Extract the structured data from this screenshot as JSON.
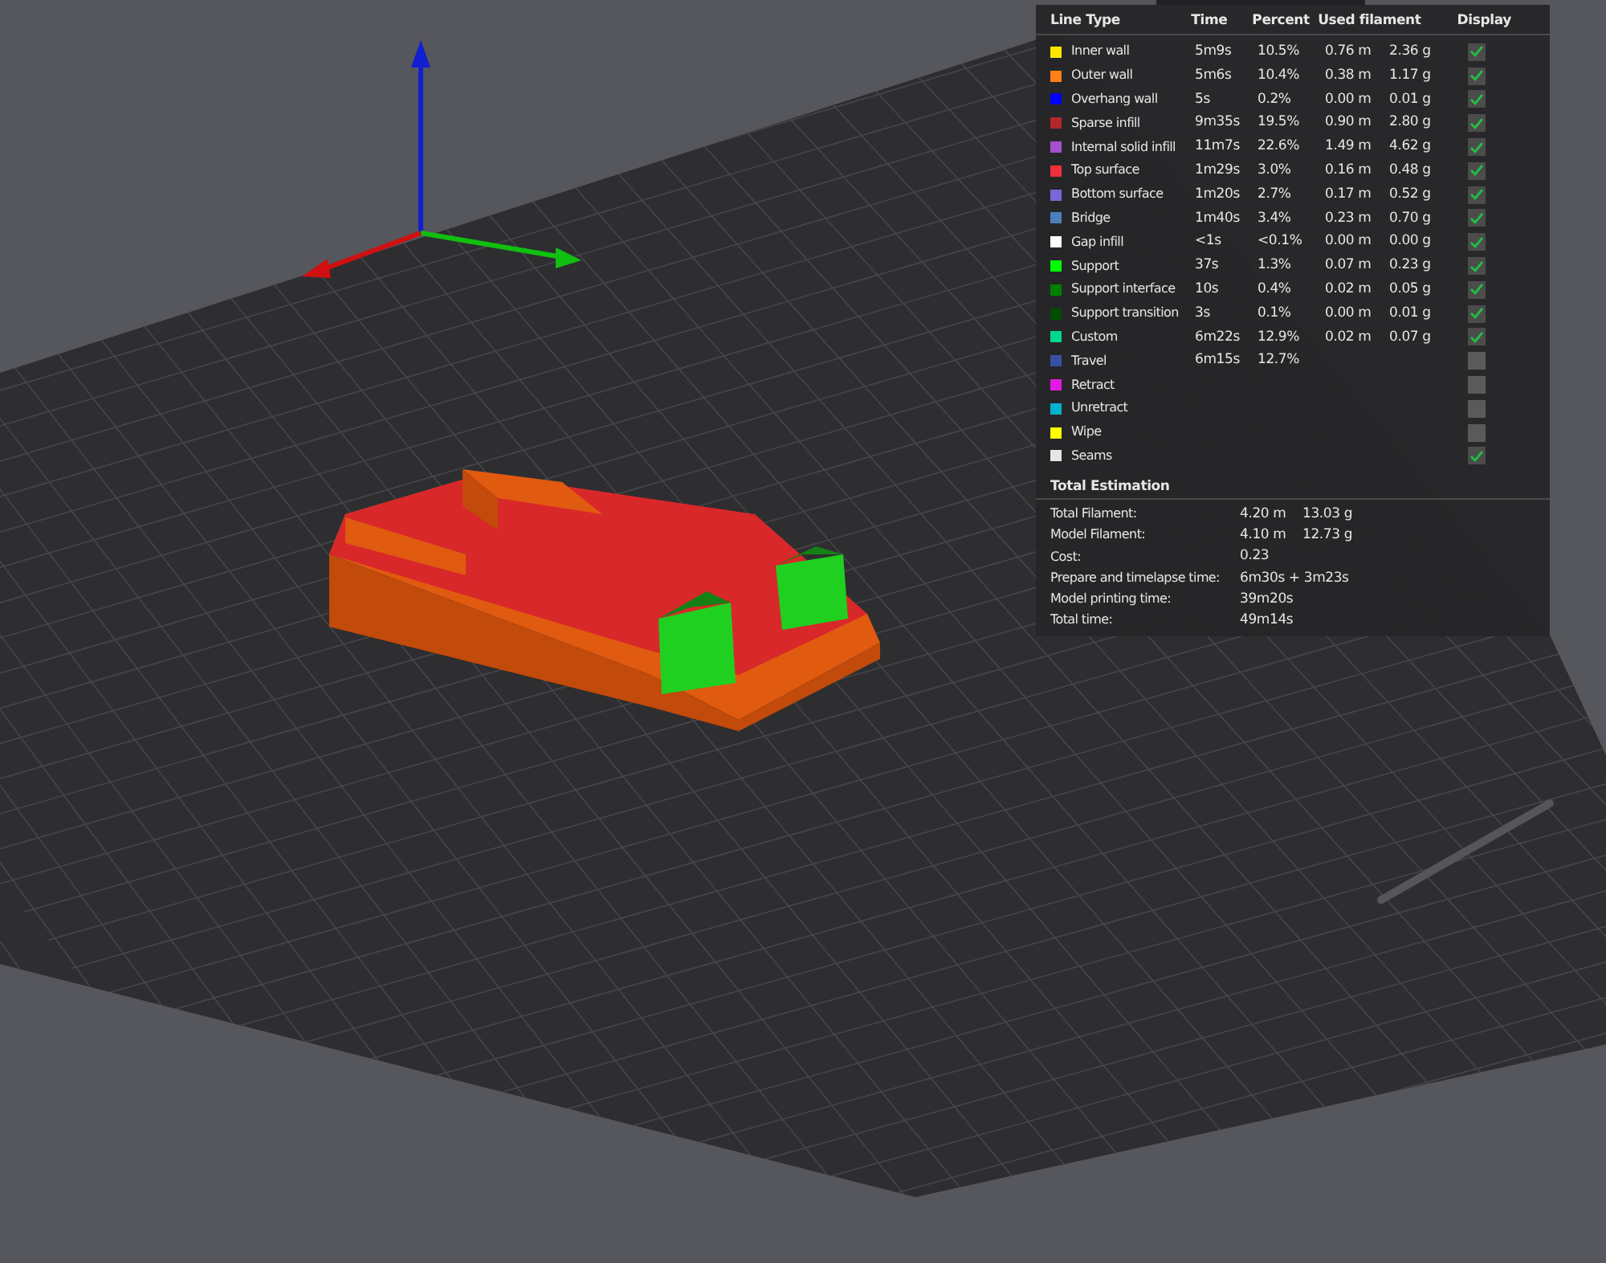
{
  "legend": {
    "columns": [
      "Line Type",
      "Time",
      "Percent",
      "Used filament",
      "Display"
    ],
    "rows": [
      {
        "name": "Inner wall",
        "color": "#ffe600",
        "time": "5m9s",
        "percent": "10.5%",
        "length": "0.76 m",
        "weight": "2.36 g",
        "checked": true
      },
      {
        "name": "Outer wall",
        "color": "#ff7f1a",
        "time": "5m6s",
        "percent": "10.4%",
        "length": "0.38 m",
        "weight": "1.17 g",
        "checked": true
      },
      {
        "name": "Overhang wall",
        "color": "#0000ff",
        "time": "5s",
        "percent": "0.2%",
        "length": "0.00 m",
        "weight": "0.01 g",
        "checked": true
      },
      {
        "name": "Sparse infill",
        "color": "#b3262a",
        "time": "9m35s",
        "percent": "19.5%",
        "length": "0.90 m",
        "weight": "2.80 g",
        "checked": true
      },
      {
        "name": "Internal solid infill",
        "color": "#a352cc",
        "time": "11m7s",
        "percent": "22.6%",
        "length": "1.49 m",
        "weight": "4.62 g",
        "checked": true
      },
      {
        "name": "Top surface",
        "color": "#f0303a",
        "time": "1m29s",
        "percent": "3.0%",
        "length": "0.16 m",
        "weight": "0.48 g",
        "checked": true
      },
      {
        "name": "Bottom surface",
        "color": "#7a66d6",
        "time": "1m20s",
        "percent": "2.7%",
        "length": "0.17 m",
        "weight": "0.52 g",
        "checked": true
      },
      {
        "name": "Bridge",
        "color": "#4d80ba",
        "time": "1m40s",
        "percent": "3.4%",
        "length": "0.23 m",
        "weight": "0.70 g",
        "checked": true
      },
      {
        "name": "Gap infill",
        "color": "#ffffff",
        "time": "<1s",
        "percent": "<0.1%",
        "length": "0.00 m",
        "weight": "0.00 g",
        "checked": true
      },
      {
        "name": "Support",
        "color": "#00ff00",
        "time": "37s",
        "percent": "1.3%",
        "length": "0.07 m",
        "weight": "0.23 g",
        "checked": true
      },
      {
        "name": "Support interface",
        "color": "#008000",
        "time": "10s",
        "percent": "0.4%",
        "length": "0.02 m",
        "weight": "0.05 g",
        "checked": true
      },
      {
        "name": "Support transition",
        "color": "#004d00",
        "time": "3s",
        "percent": "0.1%",
        "length": "0.00 m",
        "weight": "0.01 g",
        "checked": true
      },
      {
        "name": "Custom",
        "color": "#00d890",
        "time": "6m22s",
        "percent": "12.9%",
        "length": "0.02 m",
        "weight": "0.07 g",
        "checked": true
      },
      {
        "name": "Travel",
        "color": "#384fa6",
        "time": "6m15s",
        "percent": "12.7%",
        "checked": false
      },
      {
        "name": "Retract",
        "color": "#e31ae3",
        "checked": false
      },
      {
        "name": "Unretract",
        "color": "#00b3cc",
        "checked": false
      },
      {
        "name": "Wipe",
        "color": "#ffff00",
        "checked": false
      },
      {
        "name": "Seams",
        "color": "#e6e6e6",
        "checked": true
      }
    ]
  },
  "estimation": {
    "title": "Total Estimation",
    "rows": [
      {
        "label": "Total Filament:",
        "value": "4.20 m",
        "extra": "13.03 g"
      },
      {
        "label": "Model Filament:",
        "value": "4.10 m",
        "extra": "12.73 g"
      },
      {
        "label": "Cost:",
        "value": "0.23"
      },
      {
        "label": "Prepare and timelapse time:",
        "value": "6m30s + 3m23s"
      },
      {
        "label": "Model printing time:",
        "value": "39m20s"
      },
      {
        "label": "Total time:",
        "value": "49m14s"
      }
    ]
  }
}
